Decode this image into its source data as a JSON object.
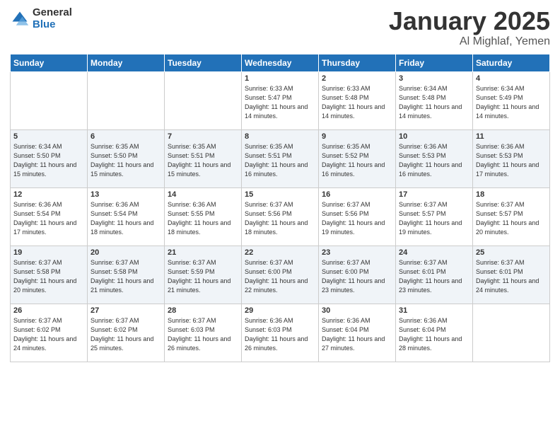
{
  "logo": {
    "general": "General",
    "blue": "Blue"
  },
  "header": {
    "month": "January 2025",
    "location": "Al Mighlaf, Yemen"
  },
  "weekdays": [
    "Sunday",
    "Monday",
    "Tuesday",
    "Wednesday",
    "Thursday",
    "Friday",
    "Saturday"
  ],
  "weeks": [
    [
      {
        "day": "",
        "sunrise": "",
        "sunset": "",
        "daylight": ""
      },
      {
        "day": "",
        "sunrise": "",
        "sunset": "",
        "daylight": ""
      },
      {
        "day": "",
        "sunrise": "",
        "sunset": "",
        "daylight": ""
      },
      {
        "day": "1",
        "sunrise": "Sunrise: 6:33 AM",
        "sunset": "Sunset: 5:47 PM",
        "daylight": "Daylight: 11 hours and 14 minutes."
      },
      {
        "day": "2",
        "sunrise": "Sunrise: 6:33 AM",
        "sunset": "Sunset: 5:48 PM",
        "daylight": "Daylight: 11 hours and 14 minutes."
      },
      {
        "day": "3",
        "sunrise": "Sunrise: 6:34 AM",
        "sunset": "Sunset: 5:48 PM",
        "daylight": "Daylight: 11 hours and 14 minutes."
      },
      {
        "day": "4",
        "sunrise": "Sunrise: 6:34 AM",
        "sunset": "Sunset: 5:49 PM",
        "daylight": "Daylight: 11 hours and 14 minutes."
      }
    ],
    [
      {
        "day": "5",
        "sunrise": "Sunrise: 6:34 AM",
        "sunset": "Sunset: 5:50 PM",
        "daylight": "Daylight: 11 hours and 15 minutes."
      },
      {
        "day": "6",
        "sunrise": "Sunrise: 6:35 AM",
        "sunset": "Sunset: 5:50 PM",
        "daylight": "Daylight: 11 hours and 15 minutes."
      },
      {
        "day": "7",
        "sunrise": "Sunrise: 6:35 AM",
        "sunset": "Sunset: 5:51 PM",
        "daylight": "Daylight: 11 hours and 15 minutes."
      },
      {
        "day": "8",
        "sunrise": "Sunrise: 6:35 AM",
        "sunset": "Sunset: 5:51 PM",
        "daylight": "Daylight: 11 hours and 16 minutes."
      },
      {
        "day": "9",
        "sunrise": "Sunrise: 6:35 AM",
        "sunset": "Sunset: 5:52 PM",
        "daylight": "Daylight: 11 hours and 16 minutes."
      },
      {
        "day": "10",
        "sunrise": "Sunrise: 6:36 AM",
        "sunset": "Sunset: 5:53 PM",
        "daylight": "Daylight: 11 hours and 16 minutes."
      },
      {
        "day": "11",
        "sunrise": "Sunrise: 6:36 AM",
        "sunset": "Sunset: 5:53 PM",
        "daylight": "Daylight: 11 hours and 17 minutes."
      }
    ],
    [
      {
        "day": "12",
        "sunrise": "Sunrise: 6:36 AM",
        "sunset": "Sunset: 5:54 PM",
        "daylight": "Daylight: 11 hours and 17 minutes."
      },
      {
        "day": "13",
        "sunrise": "Sunrise: 6:36 AM",
        "sunset": "Sunset: 5:54 PM",
        "daylight": "Daylight: 11 hours and 18 minutes."
      },
      {
        "day": "14",
        "sunrise": "Sunrise: 6:36 AM",
        "sunset": "Sunset: 5:55 PM",
        "daylight": "Daylight: 11 hours and 18 minutes."
      },
      {
        "day": "15",
        "sunrise": "Sunrise: 6:37 AM",
        "sunset": "Sunset: 5:56 PM",
        "daylight": "Daylight: 11 hours and 18 minutes."
      },
      {
        "day": "16",
        "sunrise": "Sunrise: 6:37 AM",
        "sunset": "Sunset: 5:56 PM",
        "daylight": "Daylight: 11 hours and 19 minutes."
      },
      {
        "day": "17",
        "sunrise": "Sunrise: 6:37 AM",
        "sunset": "Sunset: 5:57 PM",
        "daylight": "Daylight: 11 hours and 19 minutes."
      },
      {
        "day": "18",
        "sunrise": "Sunrise: 6:37 AM",
        "sunset": "Sunset: 5:57 PM",
        "daylight": "Daylight: 11 hours and 20 minutes."
      }
    ],
    [
      {
        "day": "19",
        "sunrise": "Sunrise: 6:37 AM",
        "sunset": "Sunset: 5:58 PM",
        "daylight": "Daylight: 11 hours and 20 minutes."
      },
      {
        "day": "20",
        "sunrise": "Sunrise: 6:37 AM",
        "sunset": "Sunset: 5:58 PM",
        "daylight": "Daylight: 11 hours and 21 minutes."
      },
      {
        "day": "21",
        "sunrise": "Sunrise: 6:37 AM",
        "sunset": "Sunset: 5:59 PM",
        "daylight": "Daylight: 11 hours and 21 minutes."
      },
      {
        "day": "22",
        "sunrise": "Sunrise: 6:37 AM",
        "sunset": "Sunset: 6:00 PM",
        "daylight": "Daylight: 11 hours and 22 minutes."
      },
      {
        "day": "23",
        "sunrise": "Sunrise: 6:37 AM",
        "sunset": "Sunset: 6:00 PM",
        "daylight": "Daylight: 11 hours and 23 minutes."
      },
      {
        "day": "24",
        "sunrise": "Sunrise: 6:37 AM",
        "sunset": "Sunset: 6:01 PM",
        "daylight": "Daylight: 11 hours and 23 minutes."
      },
      {
        "day": "25",
        "sunrise": "Sunrise: 6:37 AM",
        "sunset": "Sunset: 6:01 PM",
        "daylight": "Daylight: 11 hours and 24 minutes."
      }
    ],
    [
      {
        "day": "26",
        "sunrise": "Sunrise: 6:37 AM",
        "sunset": "Sunset: 6:02 PM",
        "daylight": "Daylight: 11 hours and 24 minutes."
      },
      {
        "day": "27",
        "sunrise": "Sunrise: 6:37 AM",
        "sunset": "Sunset: 6:02 PM",
        "daylight": "Daylight: 11 hours and 25 minutes."
      },
      {
        "day": "28",
        "sunrise": "Sunrise: 6:37 AM",
        "sunset": "Sunset: 6:03 PM",
        "daylight": "Daylight: 11 hours and 26 minutes."
      },
      {
        "day": "29",
        "sunrise": "Sunrise: 6:36 AM",
        "sunset": "Sunset: 6:03 PM",
        "daylight": "Daylight: 11 hours and 26 minutes."
      },
      {
        "day": "30",
        "sunrise": "Sunrise: 6:36 AM",
        "sunset": "Sunset: 6:04 PM",
        "daylight": "Daylight: 11 hours and 27 minutes."
      },
      {
        "day": "31",
        "sunrise": "Sunrise: 6:36 AM",
        "sunset": "Sunset: 6:04 PM",
        "daylight": "Daylight: 11 hours and 28 minutes."
      },
      {
        "day": "",
        "sunrise": "",
        "sunset": "",
        "daylight": ""
      }
    ]
  ]
}
